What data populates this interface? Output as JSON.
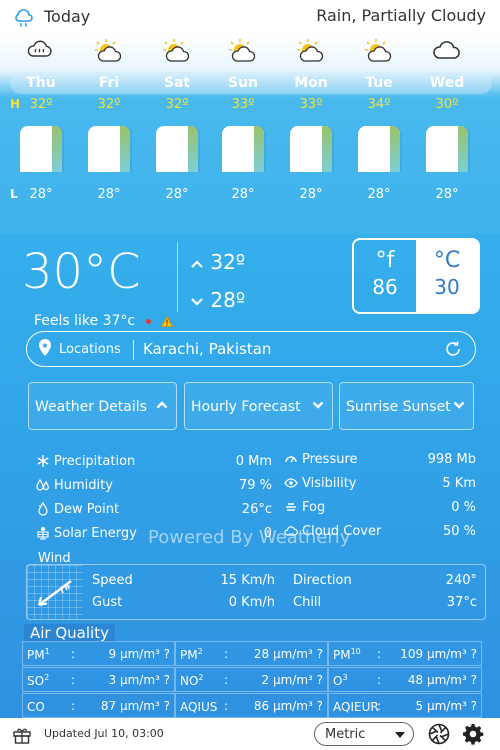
{
  "header": {
    "title": "Today",
    "condition": "Rain, Partially Cloudy"
  },
  "forecast": {
    "high_label": "H",
    "low_label": "L",
    "days": [
      {
        "day": "Thu",
        "high": "32º",
        "low": "28°",
        "icon": "rain-cloud-icon"
      },
      {
        "day": "Fri",
        "high": "32º",
        "low": "28°",
        "icon": "partly-sunny-icon"
      },
      {
        "day": "Sat",
        "high": "32º",
        "low": "28°",
        "icon": "partly-sunny-icon"
      },
      {
        "day": "Sun",
        "high": "33º",
        "low": "28°",
        "icon": "partly-sunny-icon"
      },
      {
        "day": "Mon",
        "high": "33º",
        "low": "28°",
        "icon": "partly-sunny-icon"
      },
      {
        "day": "Tue",
        "high": "34º",
        "low": "28°",
        "icon": "partly-sunny-icon"
      },
      {
        "day": "Wed",
        "high": "30º",
        "low": "28°",
        "icon": "cloud-icon"
      }
    ]
  },
  "current": {
    "temp": "30°C",
    "high": "32º",
    "low": "28º",
    "feels_like": "Feels like 37°c",
    "unit_f_symbol": "°f",
    "unit_f_value": "86",
    "unit_c_symbol": "°C",
    "unit_c_value": "30"
  },
  "location": {
    "label": "Locations",
    "city": "Karachi, Pakistan"
  },
  "tabs": [
    "Weather Details",
    "Hourly Forecast",
    "Sunrise Sunset"
  ],
  "details": {
    "left": [
      {
        "label": "Precipitation",
        "value": "0 Mm"
      },
      {
        "label": "Humidity",
        "value": "79 %"
      },
      {
        "label": "Dew Point",
        "value": "26°c"
      },
      {
        "label": "Solar Energy",
        "value": "0"
      }
    ],
    "right": [
      {
        "label": "Pressure",
        "value": "998  Mb"
      },
      {
        "label": "Visibility",
        "value": "5 Km"
      },
      {
        "label": "Fog",
        "value": "0 %"
      },
      {
        "label": "Cloud Cover",
        "value": "50 %"
      }
    ],
    "watermark": "Powered By Weatherly"
  },
  "wind": {
    "title": "Wind",
    "speed_label": "Speed",
    "speed_value": "15 Km/h",
    "gust_label": "Gust",
    "gust_value": "0 Km/h",
    "direction_label": "Direction",
    "direction_value": "240°",
    "chill_label": "Chill",
    "chill_value": "37°c"
  },
  "air_quality": {
    "title": "Air Quality",
    "cells": [
      {
        "key": "PM",
        "sup": "1",
        "value": "9 μm/m³ ?"
      },
      {
        "key": "PM",
        "sup": "2",
        "value": "28 μm/m³ ?"
      },
      {
        "key": "PM",
        "sup": "10",
        "value": "109 μm/m³ ?"
      },
      {
        "key": "SO",
        "sup": "2",
        "value": "3 μm/m³ ?"
      },
      {
        "key": "NO",
        "sup": "2",
        "value": "2 μm/m³ ?"
      },
      {
        "key": "O",
        "sup": "3",
        "value": "48 μm/m³ ?"
      },
      {
        "key": "CO",
        "sup": "",
        "value": "87 μm/m³ ?"
      },
      {
        "key": "AQIUS",
        "sup": "",
        "value": "86 μm/m³ ?"
      },
      {
        "key": "AQIEUR",
        "sup": "",
        "value": "5 μm/m³ ?"
      }
    ]
  },
  "footer": {
    "updated": "Updated Jul 10, 03:00",
    "units_select": "Metric"
  },
  "colors": {
    "high_temp": "#f7e233",
    "accent_blue": "#2f7cc0"
  }
}
